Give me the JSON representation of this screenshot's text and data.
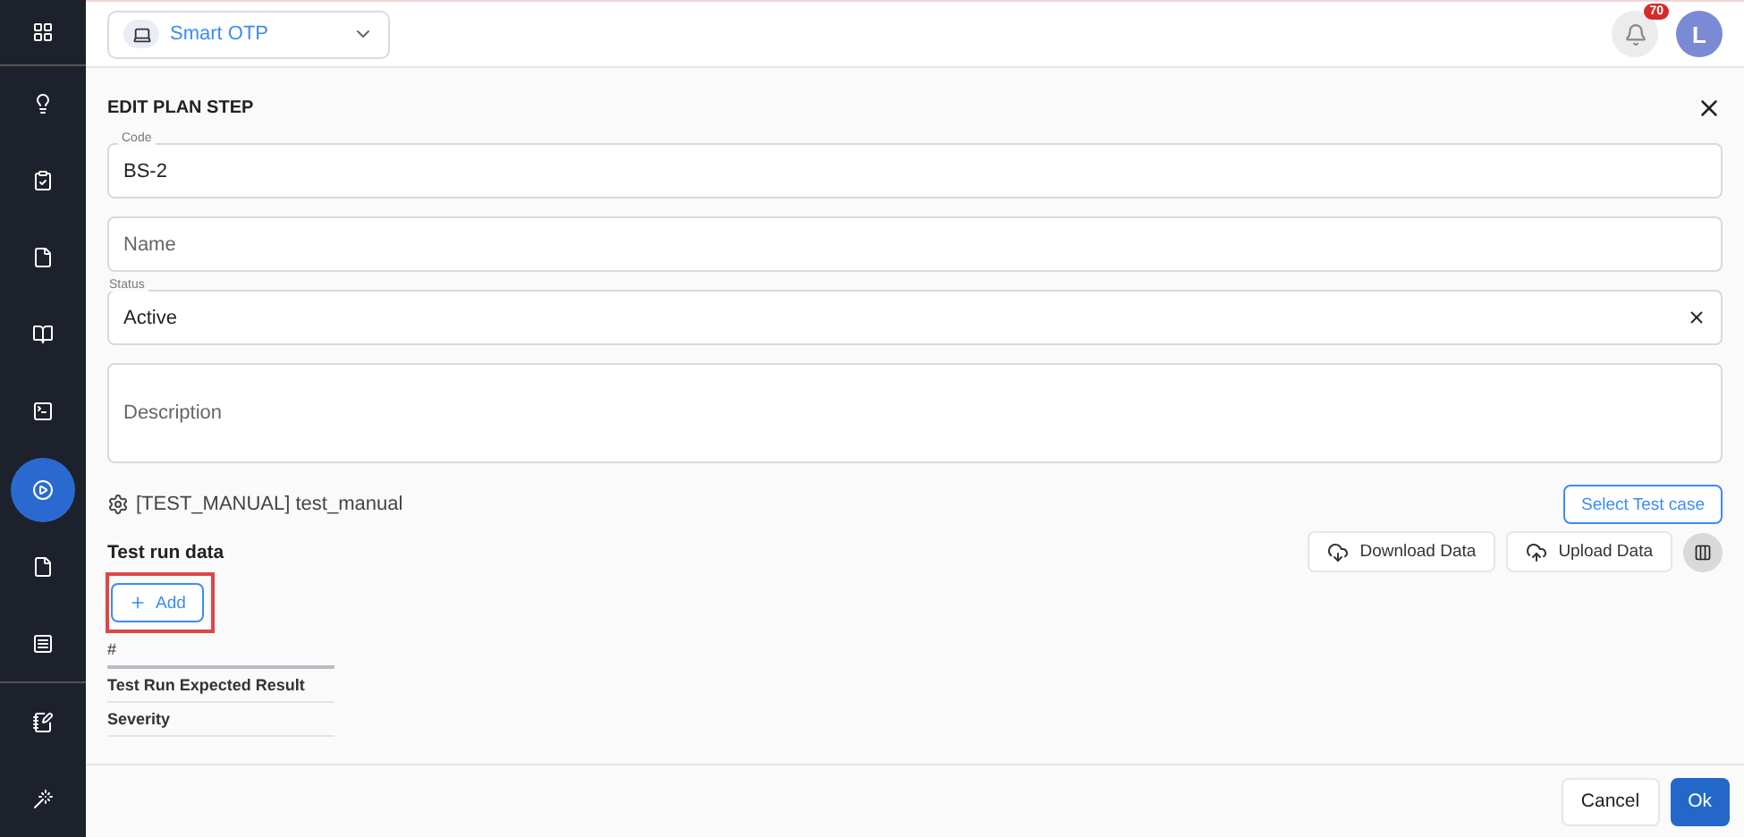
{
  "sidebar": {
    "items": [
      {
        "selected": false
      },
      {
        "selected": false
      },
      {
        "selected": false
      },
      {
        "selected": false
      },
      {
        "selected": false
      },
      {
        "selected": false
      },
      {
        "selected": true
      },
      {
        "selected": false
      },
      {
        "selected": false
      },
      {
        "selected": false
      },
      {
        "selected": false
      }
    ]
  },
  "topbar": {
    "project": "Smart OTP",
    "notifications": "70",
    "avatar": "L"
  },
  "dialog": {
    "title": "EDIT PLAN STEP",
    "fields": [
      {
        "kind": "text",
        "label": "Code",
        "value": "BS-2"
      },
      {
        "kind": "text",
        "placeholder": "Name"
      },
      {
        "kind": "select",
        "label": "Status",
        "value": "Active"
      },
      {
        "kind": "textarea",
        "placeholder": "Description"
      }
    ],
    "test_case": "[TEST_MANUAL] test_manual",
    "select_button": "Select Test case",
    "section_title": "Test run data",
    "download_button": "Download Data",
    "upload_button": "Upload Data",
    "add_button": {
      "label": "Add",
      "highlighted": true
    },
    "table_headers": [
      "#",
      "Test Run Expected Result",
      "Severity"
    ],
    "cancel_button": "Cancel",
    "ok_button": "Ok"
  }
}
